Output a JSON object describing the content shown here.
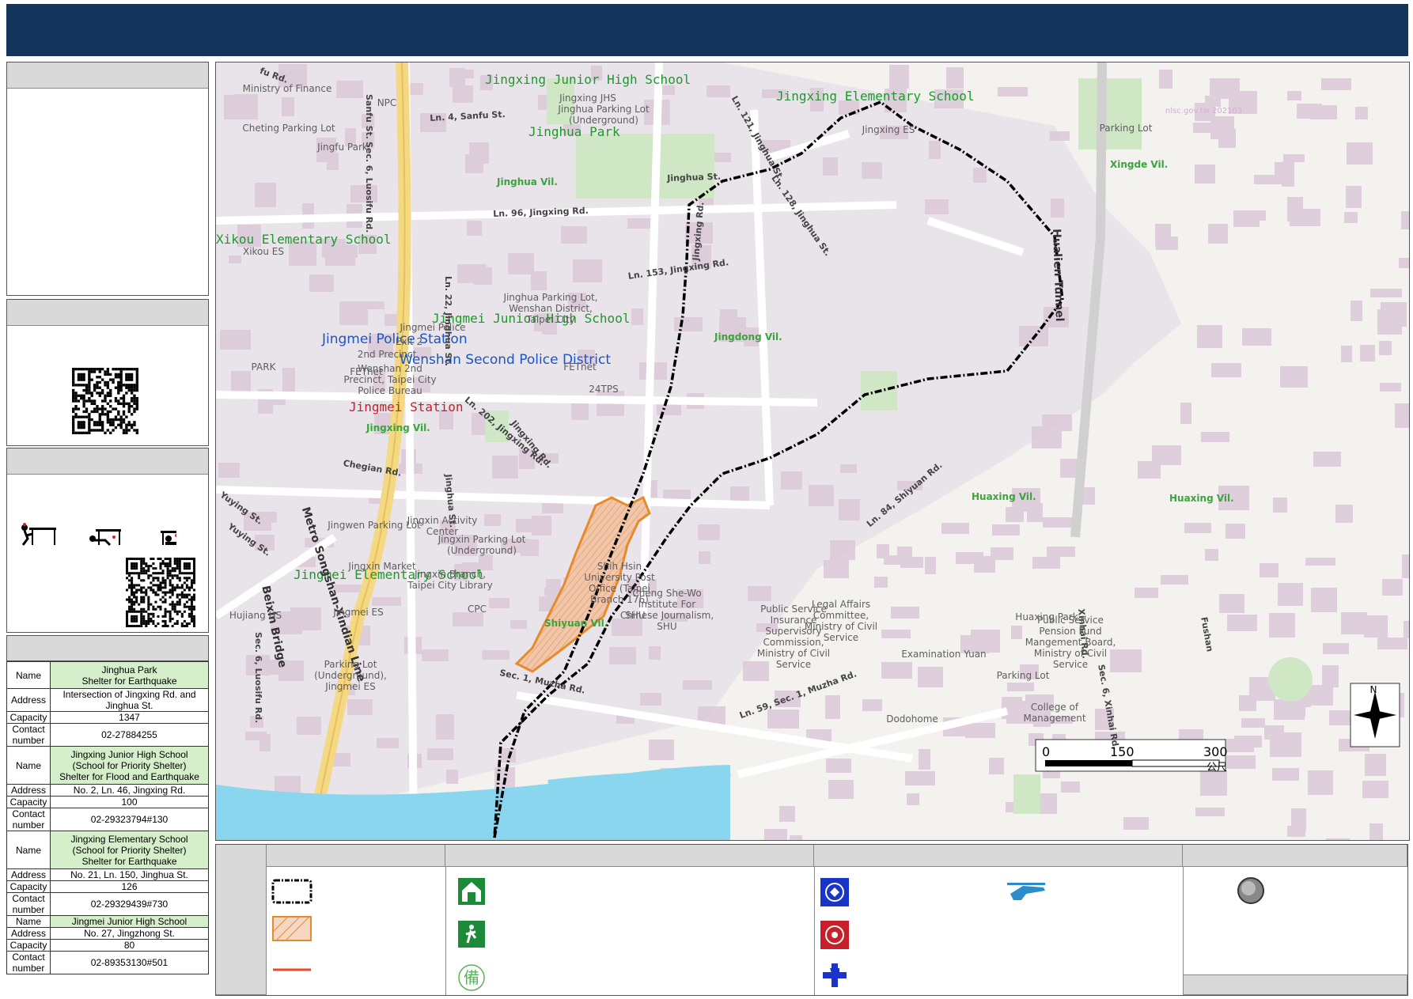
{
  "map": {
    "watermark": "nlsc.gov.tw 202103",
    "labels": {
      "shelters": [
        "Jingxing Junior High School",
        "Jingxing Elementary School",
        "Jinghua Park",
        "Xikou Elementary School",
        "Jingmei Junior High School",
        "Jingmei Elementary School"
      ],
      "police": [
        "Jingmei Police Station",
        "Wenshan Second Police District"
      ],
      "fire": "Jingmei Station",
      "roads": [
        "Sec. 6, Luosifu Rd.",
        "Ln. 4, Sanfu St.",
        "Ln. 96, Jingxing Rd.",
        "Ln. 22, Jinghua St.",
        "Ln. 153, Jingxing Rd.",
        "Ln. 121, Jinghua St.",
        "Ln. 128, Jinghua St.",
        "Ln. 202, Jingxing Rd.",
        "Chegian Rd.",
        "Jinghua St.",
        "Yuying St.",
        "Jingxing Rd.",
        "Jinghua St.",
        "Ln. 84, Shiyuan Rd.",
        "Sec. 1, Muzha Rd.",
        "Ln. 59, Sec. 1, Muzha Rd.",
        "Sec. 6, Xinhai Rd.",
        "Sec. 6, Luosifu Rd.",
        "Sanfu St.",
        "Yuying St.",
        "Jingxing Rd.",
        "Xinhai Rd.",
        "Fushan",
        "fu Rd."
      ],
      "transit": [
        "Metro Songshan-Xindian Line",
        "Beixin Bridge",
        "Hualien Tunnel"
      ],
      "villages": [
        "Jinghua Vil.",
        "Jingxing Vil.",
        "Jingdong Vil.",
        "Shiyuan Vil.",
        "Huaxing Vil.",
        "Huaxing Vil.",
        "Xingde Vil."
      ],
      "places": [
        "Ministry of Finance",
        "NPC",
        "Cheting Parking Lot",
        "Jingfu Park",
        "Jinghua Parking Lot (Underground)",
        "Jingxing JHS",
        "Jingxing ES",
        "Parking Lot",
        "Xikou ES",
        "PARK",
        "FETnet",
        "Jingmei Police",
        "Exit 2",
        "2nd Precinct",
        "Wenshan 2nd Precinct, Taipei City Police Bureau",
        "Jinghua Parking Lot, Wenshan District, Taipei City",
        "FETnet",
        "24TPS",
        "Jingwen Parking Lot",
        "Jingxin Activity Center",
        "Jingxin Parking Lot (Underground)",
        "Jingxin Market",
        "Jingxin Branch, Taipei City Library",
        "Jingmei ES",
        "Hujiang HS",
        "CPC",
        "Parking Lot (Underground), Jingmei ES",
        "Shih Hsin University Post Office (Taipei Branch 176)",
        "Cheng She-Wo Institute For Chinese Journalism, SHU",
        "SHU",
        "Public Service Insurance Supervisory Commission, Ministry of Civil Service",
        "Legal Affairs Committee, Ministry of Civil Service",
        "Huaxing Park",
        "Public Service Pension Fund Mangement Board, Ministry of Civil Service",
        "Examination Yuan",
        "Dodohome",
        "Parking Lot",
        "College of Management"
      ]
    },
    "north_label": "N",
    "scale": {
      "ticks": [
        "0",
        "150",
        "300"
      ],
      "unit": "公尺"
    }
  },
  "shelter_table": [
    {
      "name": "Jinghua Park\nShelter for Earthquake",
      "address": "Intersection of Jingxing Rd. and Jinghua St.",
      "capacity": "1347",
      "contact": "02-27884255"
    },
    {
      "name": "Jingxing Junior High School\n(School for Priority Shelter)\nShelter for Flood and Earthquake",
      "address": "No. 2, Ln. 46, Jingxing Rd.",
      "capacity": "100",
      "contact": "02-29323794#130"
    },
    {
      "name": "Jingxing Elementary School\n(School for Priority Shelter)\nShelter for Earthquake",
      "address": "No. 21, Ln. 150, Jinghua St.",
      "capacity": "126",
      "contact": "02-29329439#730"
    },
    {
      "name": "Jingmei Junior High School",
      "address": "No. 27, Jingzhong St.",
      "capacity": "80",
      "contact": "02-89353130#501"
    }
  ],
  "table_labels": {
    "name": "Name",
    "address": "Address",
    "capacity": "Capacity",
    "contact": "Contact\nnumber"
  },
  "icons": [
    "police-badge-icon",
    "fire-station-icon",
    "ambulance-icon",
    "helicopter-icon",
    "shelter-house-icon",
    "evacuation-person-icon",
    "standby-shelter-icon",
    "parking-icon",
    "emergency-point-icon",
    "qr-code-icon",
    "drop-cover-hold-icon"
  ],
  "colors": {
    "banner": "#14345b",
    "shelter_green": "#1d8a3a",
    "police_blue": "#1a33c8",
    "fire_red": "#c8202a",
    "hazard_orange": "#e88a2a",
    "boundary": "#000000",
    "river": "#8ad6ee"
  }
}
